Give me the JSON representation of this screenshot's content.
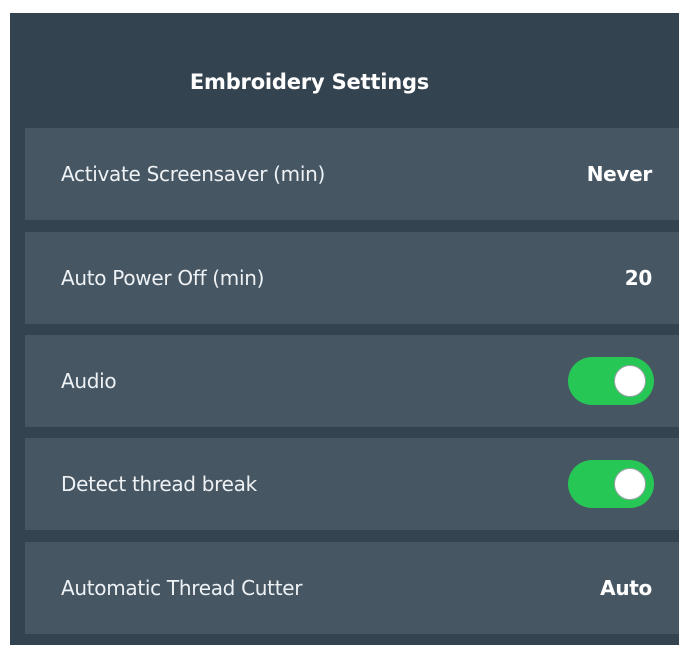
{
  "header": {
    "title": "Embroidery Settings"
  },
  "settings": [
    {
      "label": "Activate Screensaver (min)",
      "value": "Never"
    },
    {
      "label": "Auto Power Off (min)",
      "value": "20"
    },
    {
      "label": "Audio",
      "toggle": true
    },
    {
      "label": "Detect thread break",
      "toggle": true
    },
    {
      "label": "Automatic Thread Cutter",
      "value": "Auto"
    }
  ],
  "colors": {
    "panel_bg": "#344350",
    "row_bg": "#465663",
    "toggle_on": "#27c756",
    "text": "#ffffff"
  }
}
